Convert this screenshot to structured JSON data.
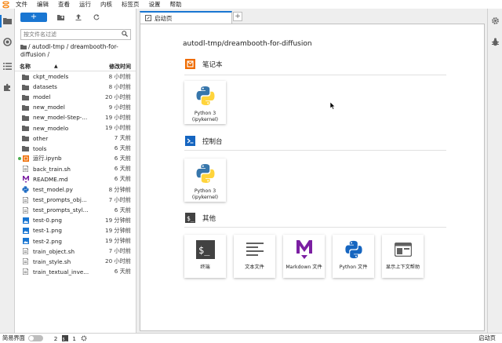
{
  "menubar": {
    "items": [
      "文件",
      "编辑",
      "查看",
      "运行",
      "内核",
      "标签页",
      "设置",
      "帮助"
    ]
  },
  "filebrowser": {
    "new_label": "+",
    "search": {
      "placeholder": "按文件名过滤"
    },
    "breadcrumb": "/ autodl-tmp / dreambooth-for-diffusion /",
    "columns": {
      "name": "名称",
      "modified": "修改时间"
    },
    "files": [
      {
        "name": "ckpt_models",
        "modified": "8 小时前",
        "type": "folder"
      },
      {
        "name": "datasets",
        "modified": "8 小时前",
        "type": "folder"
      },
      {
        "name": "model",
        "modified": "20 小时前",
        "type": "folder"
      },
      {
        "name": "new_model",
        "modified": "9 小时前",
        "type": "folder"
      },
      {
        "name": "new_model-Step-...",
        "modified": "19 小时前",
        "type": "folder"
      },
      {
        "name": "new_modelo",
        "modified": "19 小时前",
        "type": "folder"
      },
      {
        "name": "other",
        "modified": "7 天前",
        "type": "folder"
      },
      {
        "name": "tools",
        "modified": "6 天前",
        "type": "folder"
      },
      {
        "name": "运行.ipynb",
        "modified": "6 天前",
        "type": "notebook",
        "running": true
      },
      {
        "name": "back_train.sh",
        "modified": "6 天前",
        "type": "file"
      },
      {
        "name": "README.md",
        "modified": "6 天前",
        "type": "markdown"
      },
      {
        "name": "test_model.py",
        "modified": "8 分钟前",
        "type": "python"
      },
      {
        "name": "test_prompts_obj...",
        "modified": "7 小时前",
        "type": "file"
      },
      {
        "name": "test_prompts_styl...",
        "modified": "6 天前",
        "type": "file"
      },
      {
        "name": "test-0.png",
        "modified": "19 分钟前",
        "type": "image"
      },
      {
        "name": "test-1.png",
        "modified": "19 分钟前",
        "type": "image"
      },
      {
        "name": "test-2.png",
        "modified": "19 分钟前",
        "type": "image"
      },
      {
        "name": "train_object.sh",
        "modified": "7 小时前",
        "type": "file"
      },
      {
        "name": "train_style.sh",
        "modified": "20 小时前",
        "type": "file"
      },
      {
        "name": "train_textual_inve...",
        "modified": "6 天前",
        "type": "file"
      }
    ]
  },
  "main": {
    "tab_label": "启动页",
    "tab_add": "+",
    "path": "autodl-tmp/dreambooth-for-diffusion",
    "sections": {
      "notebook": {
        "title": "笔记本",
        "cards": [
          {
            "label": "Python 3\n(ipykernel)",
            "icon": "python-logo-icon"
          }
        ]
      },
      "console": {
        "title": "控制台",
        "cards": [
          {
            "label": "Python 3\n(ipykernel)",
            "icon": "python-logo-icon"
          }
        ]
      },
      "other": {
        "title": "其他",
        "cards": [
          {
            "label": "终端",
            "icon": "terminal-icon"
          },
          {
            "label": "文本文件",
            "icon": "text-file-icon"
          },
          {
            "label": "Markdown 文件",
            "icon": "markdown-icon"
          },
          {
            "label": "Python 文件",
            "icon": "python-logo-icon"
          },
          {
            "label": "显示上下文帮助",
            "icon": "context-help-icon"
          }
        ]
      }
    }
  },
  "statusbar": {
    "simple_mode_label": "简易界面",
    "terminals_count": "2",
    "kernels_count": "1",
    "right_label": "启动页"
  },
  "colors": {
    "accent": "#1976d2",
    "notebook_icon": "#ef6c00",
    "console_icon": "#1565c0",
    "markdown": "#7b1fa2",
    "running_dot": "#4caf50"
  }
}
